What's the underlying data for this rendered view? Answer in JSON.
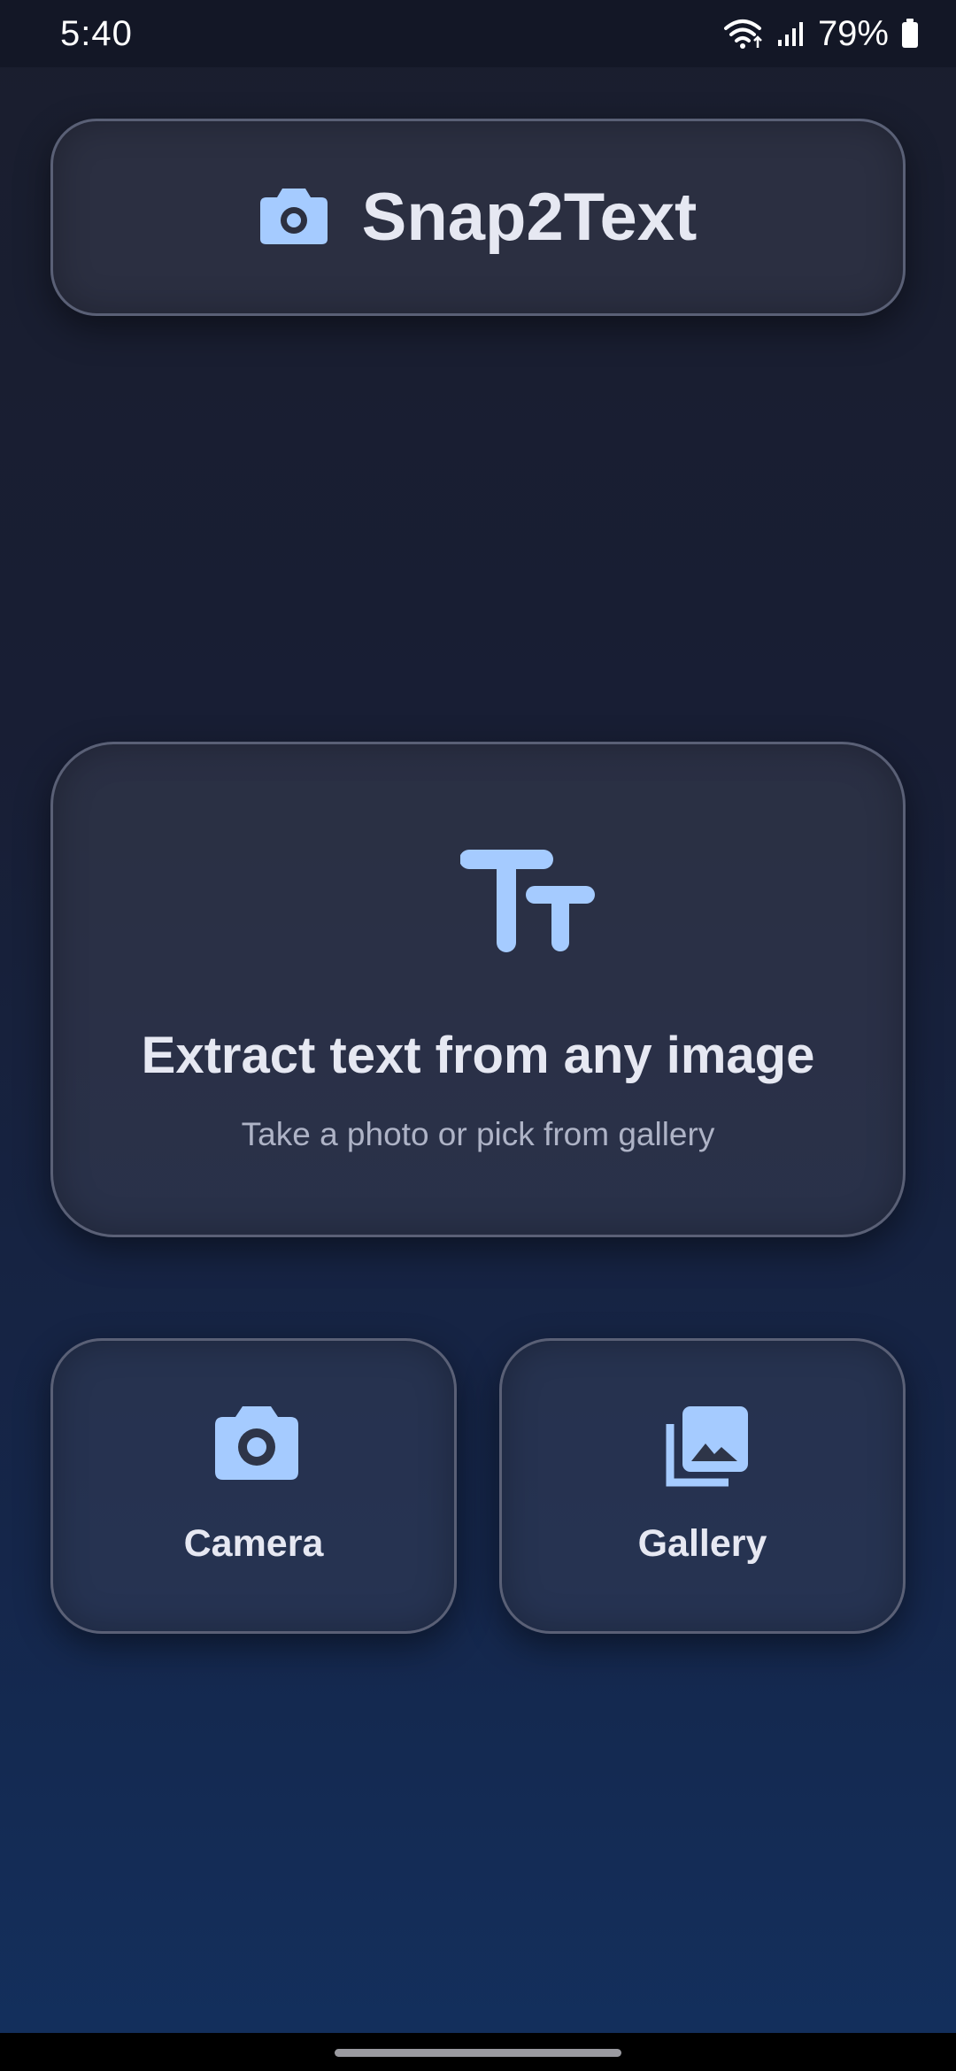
{
  "status_bar": {
    "time": "5:40",
    "battery": "79%",
    "icons": [
      "wifi-icon",
      "signal-icon",
      "battery-icon"
    ]
  },
  "header": {
    "icon": "camera-icon",
    "title": "Snap2Text"
  },
  "hero": {
    "icon": "text-size-icon",
    "title": "Extract text from any image",
    "subtitle": "Take a photo or pick from gallery"
  },
  "actions": [
    {
      "icon": "camera-icon",
      "label": "Camera"
    },
    {
      "icon": "gallery-icon",
      "label": "Gallery"
    }
  ],
  "colors": {
    "accent": "#a5cbff",
    "background_top": "#1a1e2e",
    "background_bottom": "#13305e",
    "card_border": "#5a6076"
  }
}
